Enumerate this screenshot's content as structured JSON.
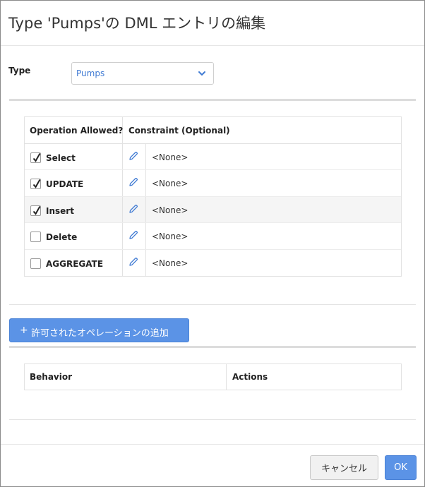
{
  "dialog": {
    "title": "Type 'Pumps'の DML エントリの編集"
  },
  "type_field": {
    "label": "Type",
    "selected": "Pumps"
  },
  "operations_table": {
    "headers": [
      "Operation Allowed?",
      "Constraint (Optional)"
    ],
    "rows": [
      {
        "name": "Select",
        "checked": true,
        "constraint": "<None>"
      },
      {
        "name": "UPDATE",
        "checked": true,
        "constraint": "<None>"
      },
      {
        "name": "Insert",
        "checked": true,
        "constraint": "<None>"
      },
      {
        "name": "Delete",
        "checked": false,
        "constraint": "<None>"
      },
      {
        "name": "AGGREGATE",
        "checked": false,
        "constraint": "<None>"
      }
    ]
  },
  "add_button": {
    "icon": "plus-icon",
    "label": "許可されたオペレーションの追加"
  },
  "behavior_table": {
    "headers": [
      "Behavior",
      "Actions"
    ]
  },
  "footer": {
    "cancel_label": "キャンセル",
    "ok_label": "OK"
  },
  "colors": {
    "accent": "#5b93e6",
    "link": "#3f7ad3"
  }
}
